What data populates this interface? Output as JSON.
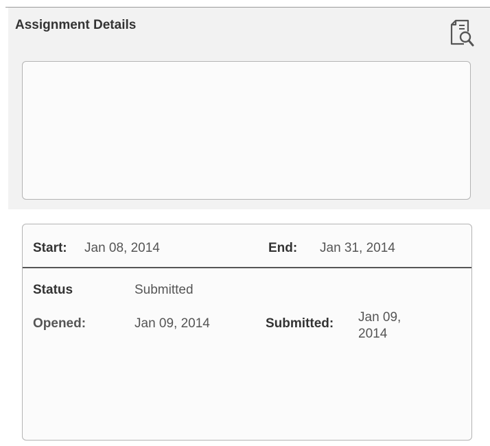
{
  "panel": {
    "title": "Assignment Details",
    "preview_icon": "document-search-icon",
    "description": ""
  },
  "dates": {
    "start_label": "Start:",
    "start_value": "Jan 08, 2014",
    "end_label": "End:",
    "end_value": "Jan 31, 2014"
  },
  "status": {
    "status_label": "Status",
    "status_value": "Submitted",
    "opened_label": "Opened:",
    "opened_value": "Jan 09, 2014",
    "submitted_label": "Submitted:",
    "submitted_value": "Jan 09, 2014"
  },
  "colors": {
    "panel_background": "#f2f2f2",
    "border": "#b3b3b3",
    "label_text": "#333333",
    "value_text": "#555555"
  }
}
